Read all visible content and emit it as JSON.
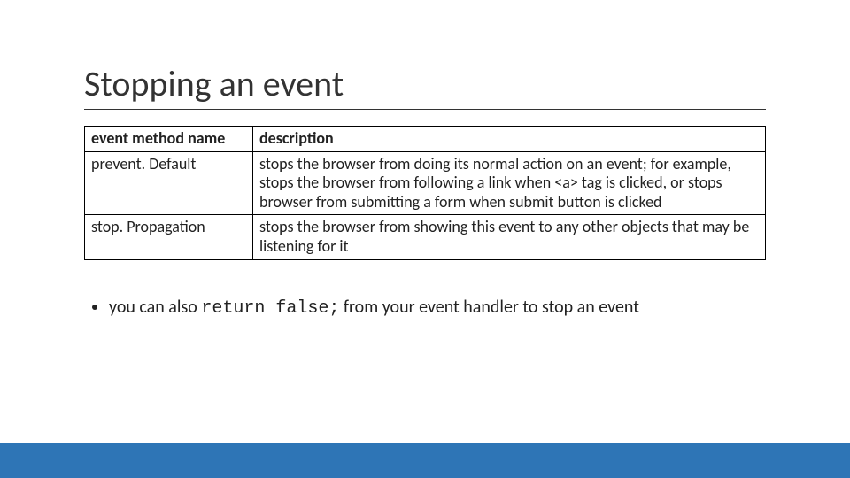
{
  "slide": {
    "title": "Stopping an event",
    "table": {
      "headers": {
        "method": "event method name",
        "description": "description"
      },
      "rows": [
        {
          "method": "prevent. Default",
          "description": "stops the browser from doing its normal action on an event; for example, stops the browser from following a link when <a> tag is clicked, or stops browser from submitting a form when submit button is clicked"
        },
        {
          "method": "stop. Propagation",
          "description": "stops the browser from showing this event to any other objects that may be listening for it"
        }
      ]
    },
    "bullet": {
      "prefix": "you can also ",
      "code": "return false;",
      "suffix": " from your event handler to stop an event"
    }
  }
}
